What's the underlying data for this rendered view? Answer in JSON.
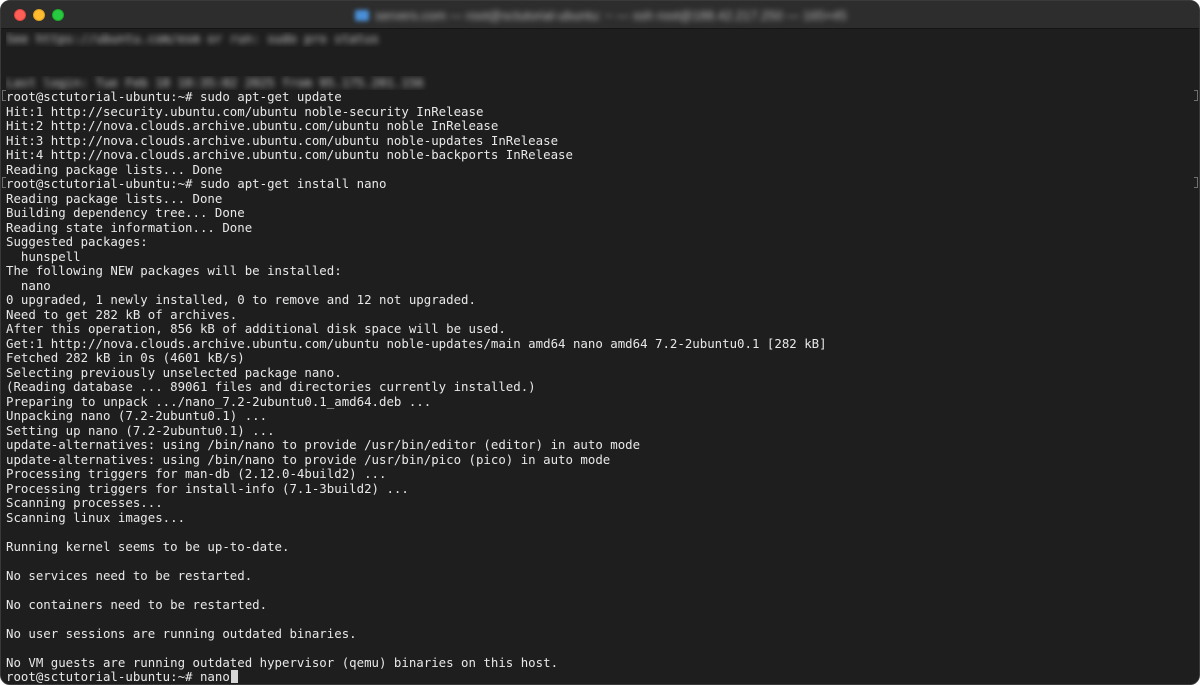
{
  "window": {
    "title": "servers.com — root@sctutorial-ubuntu: ~ — ssh root@188.42.217.250 — 165×45",
    "colors": {
      "background": "#1e1e1e",
      "titlebar": "#2d2d2d",
      "text": "#e8e8e8",
      "close": "#ff5f57",
      "minimize": "#febc2e",
      "zoom": "#28c840"
    }
  },
  "terminal": {
    "lines": [
      "See https://ubuntu.com/esm or run: sudo pro status",
      "",
      "",
      "Last login: Tue Feb 18 10:35:02 2025 from 95.175.201.156",
      "root@sctutorial-ubuntu:~# sudo apt-get update",
      "Hit:1 http://security.ubuntu.com/ubuntu noble-security InRelease",
      "Hit:2 http://nova.clouds.archive.ubuntu.com/ubuntu noble InRelease",
      "Hit:3 http://nova.clouds.archive.ubuntu.com/ubuntu noble-updates InRelease",
      "Hit:4 http://nova.clouds.archive.ubuntu.com/ubuntu noble-backports InRelease",
      "Reading package lists... Done",
      "root@sctutorial-ubuntu:~# sudo apt-get install nano",
      "Reading package lists... Done",
      "Building dependency tree... Done",
      "Reading state information... Done",
      "Suggested packages:",
      "  hunspell",
      "The following NEW packages will be installed:",
      "  nano",
      "0 upgraded, 1 newly installed, 0 to remove and 12 not upgraded.",
      "Need to get 282 kB of archives.",
      "After this operation, 856 kB of additional disk space will be used.",
      "Get:1 http://nova.clouds.archive.ubuntu.com/ubuntu noble-updates/main amd64 nano amd64 7.2-2ubuntu0.1 [282 kB]",
      "Fetched 282 kB in 0s (4601 kB/s)",
      "Selecting previously unselected package nano.",
      "(Reading database ... 89061 files and directories currently installed.)",
      "Preparing to unpack .../nano_7.2-2ubuntu0.1_amd64.deb ...",
      "Unpacking nano (7.2-2ubuntu0.1) ...",
      "Setting up nano (7.2-2ubuntu0.1) ...",
      "update-alternatives: using /bin/nano to provide /usr/bin/editor (editor) in auto mode",
      "update-alternatives: using /bin/nano to provide /usr/bin/pico (pico) in auto mode",
      "Processing triggers for man-db (2.12.0-4build2) ...",
      "Processing triggers for install-info (7.1-3build2) ...",
      "Scanning processes...",
      "Scanning linux images...",
      "",
      "Running kernel seems to be up-to-date.",
      "",
      "No services need to be restarted.",
      "",
      "No containers need to be restarted.",
      "",
      "No user sessions are running outdated binaries.",
      "",
      "No VM guests are running outdated hypervisor (qemu) binaries on this host."
    ],
    "prompt": "root@sctutorial-ubuntu:~# ",
    "current_input": "nano"
  }
}
